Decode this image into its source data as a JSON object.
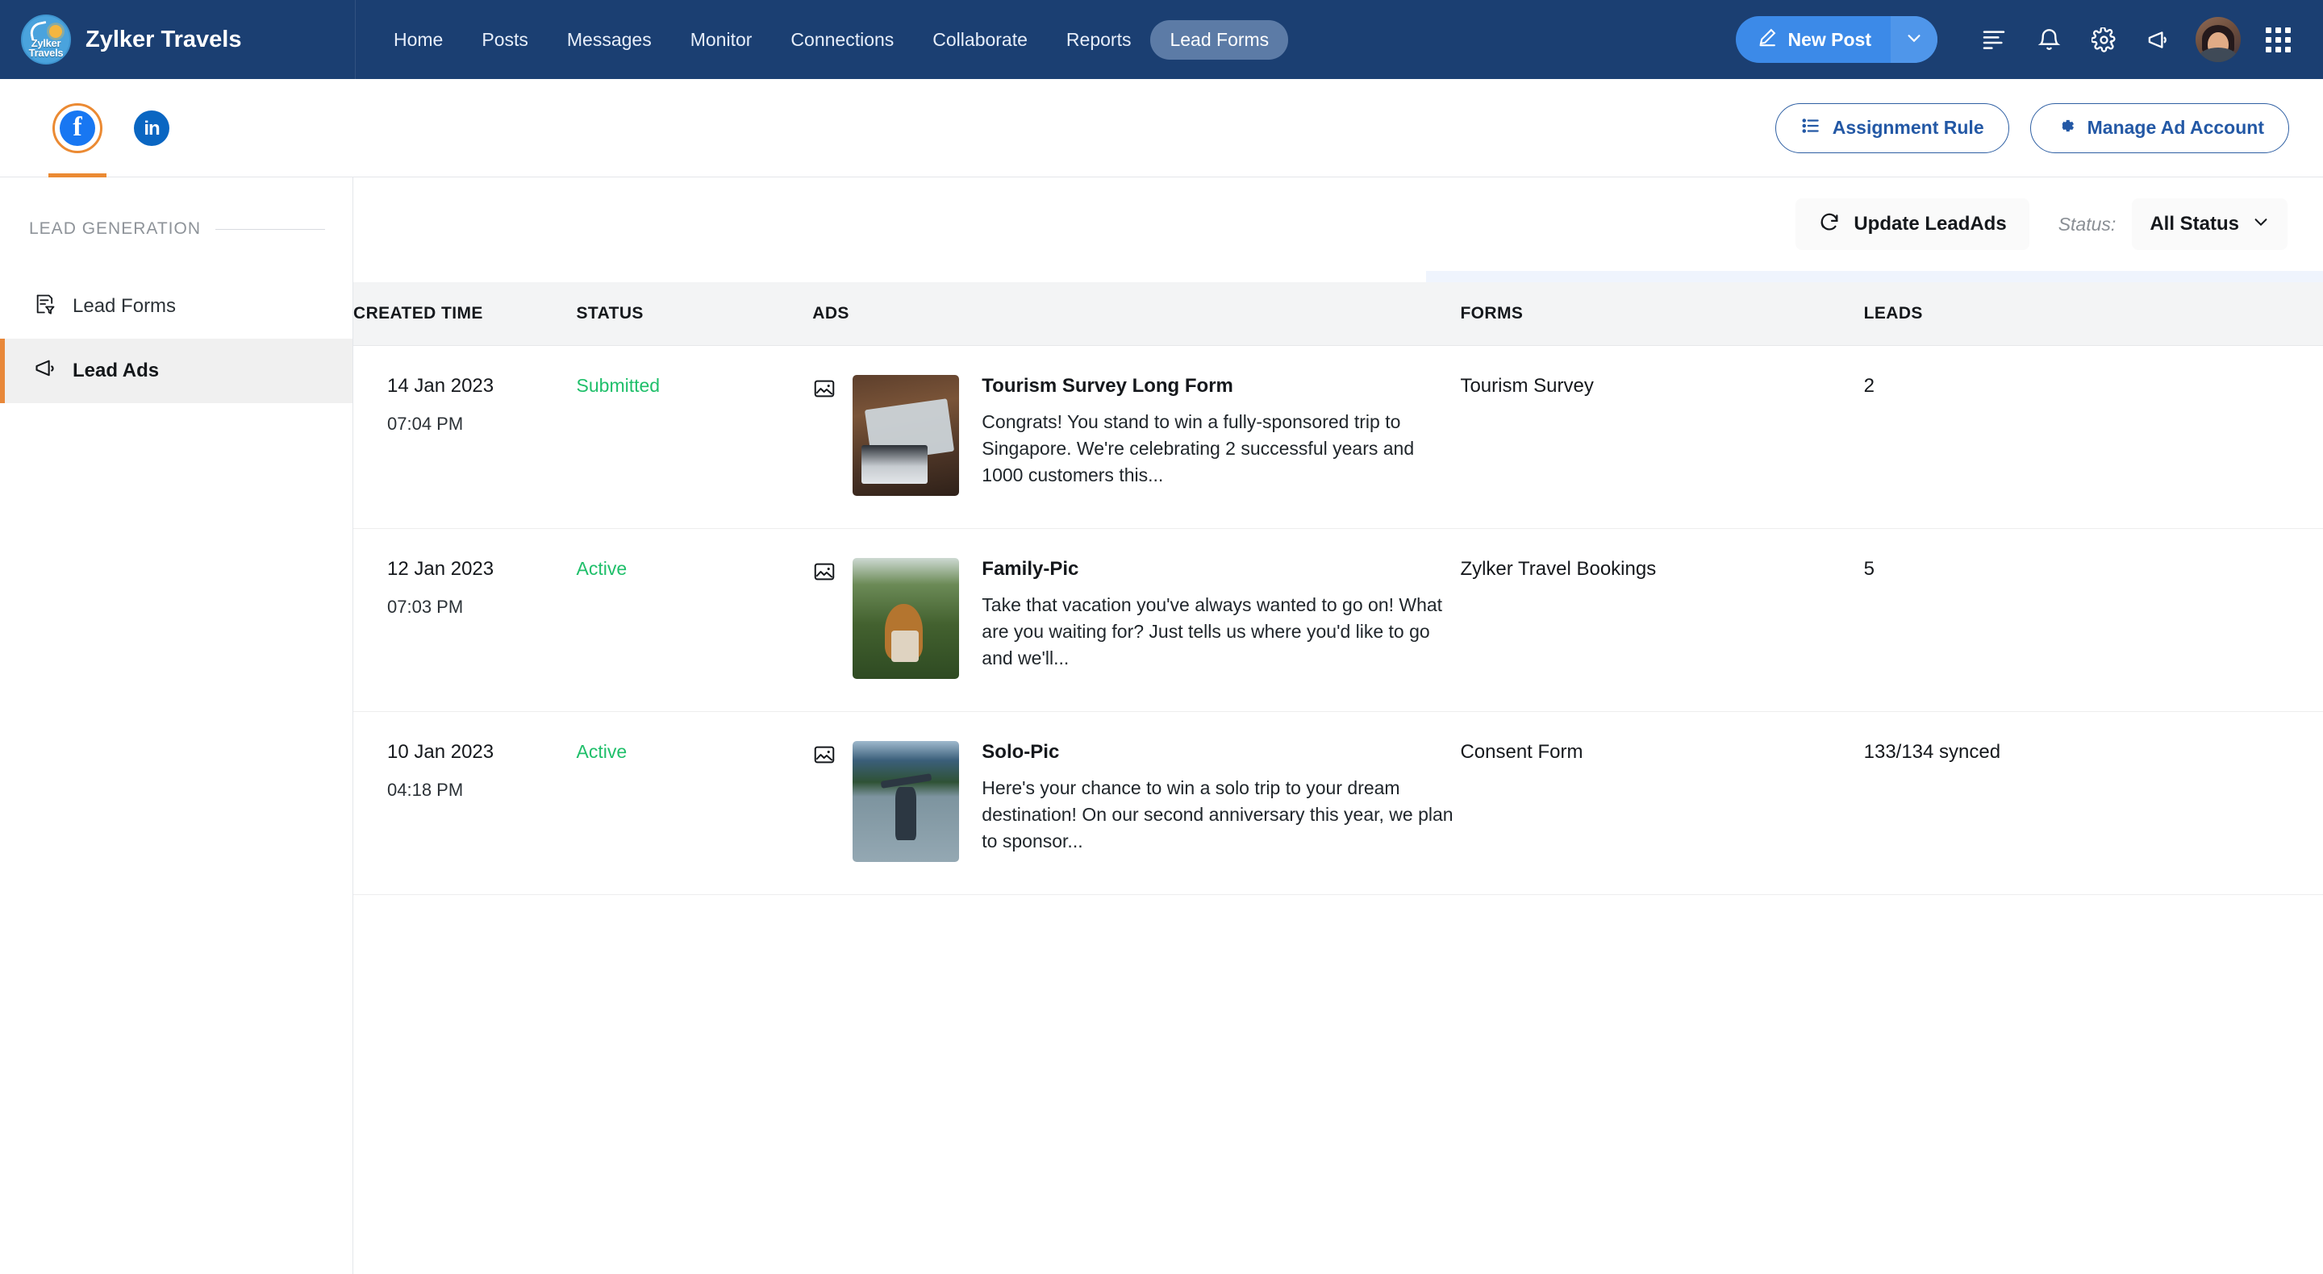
{
  "topnav": {
    "brand": "Zylker Travels",
    "logo_line1": "Zylker",
    "logo_line2": "Travels",
    "links": [
      {
        "label": "Home",
        "active": false
      },
      {
        "label": "Posts",
        "active": false
      },
      {
        "label": "Messages",
        "active": false
      },
      {
        "label": "Monitor",
        "active": false
      },
      {
        "label": "Connections",
        "active": false
      },
      {
        "label": "Collaborate",
        "active": false
      },
      {
        "label": "Reports",
        "active": false
      },
      {
        "label": "Lead Forms",
        "active": true
      }
    ],
    "new_post_label": "New Post",
    "new_post_color": "#3c8ae8",
    "icons": [
      "pencil-icon",
      "chevron-down-icon",
      "list-lines-icon",
      "bell-icon",
      "gear-icon",
      "megaphone-icon",
      "avatar",
      "apps-grid-icon"
    ]
  },
  "subheader": {
    "channels": [
      {
        "name": "facebook",
        "glyph": "f",
        "selected": true
      },
      {
        "name": "linkedin",
        "glyph": "in",
        "selected": false
      }
    ],
    "selected_accent": "#eb8a33",
    "assignment_rule_label": "Assignment Rule",
    "manage_ad_account_label": "Manage Ad Account",
    "action_color": "#2358a5"
  },
  "sidebar": {
    "section_label": "LEAD GENERATION",
    "items": [
      {
        "label": "Lead Forms",
        "icon": "form-filter-icon",
        "active": false
      },
      {
        "label": "Lead Ads",
        "icon": "megaphone-icon",
        "active": true
      }
    ],
    "active_accent": "#e8883a"
  },
  "toolbar": {
    "update_label": "Update LeadAds",
    "update_icon": "refresh-icon",
    "status_label": "Status:",
    "status_value": "All Status",
    "status_options": [
      "All Status"
    ]
  },
  "table": {
    "columns": [
      "CREATED TIME",
      "STATUS",
      "ADS",
      "FORMS",
      "LEADS"
    ],
    "status_color": "#1fbf6a",
    "rows": [
      {
        "date": "14 Jan 2023",
        "time": "07:04 PM",
        "status": "Submitted",
        "thumb": "desk-map-laptop",
        "ad_title": "Tourism Survey Long Form",
        "ad_desc": "Congrats! You stand to win a fully-sponsored trip to Singapore. We're celebrating 2 successful years and 1000 customers this...",
        "form": "Tourism Survey",
        "leads": "2"
      },
      {
        "date": "12 Jan 2023",
        "time": "07:03 PM",
        "status": "Active",
        "thumb": "family-field",
        "ad_title": "Family-Pic",
        "ad_desc": "Take that vacation you've always wanted to go on! What are you waiting for? Just tells us where you'd like to go and we'll...",
        "form": "Zylker Travel Bookings",
        "leads": "5"
      },
      {
        "date": "10 Jan 2023",
        "time": "04:18 PM",
        "status": "Active",
        "thumb": "solo-lake-mountain",
        "ad_title": "Solo-Pic",
        "ad_desc": "Here's your chance to win a solo trip to your dream destination! On our second anniversary this year, we plan to sponsor...",
        "form": "Consent Form",
        "leads": "133/134 synced"
      }
    ]
  }
}
